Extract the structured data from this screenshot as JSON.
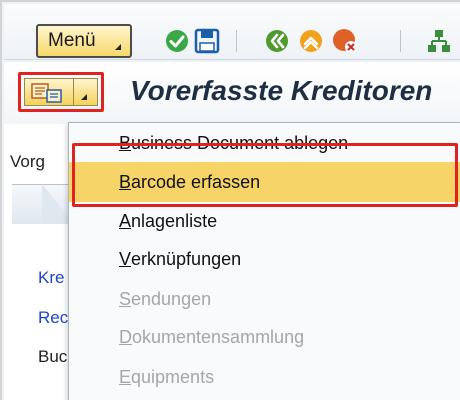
{
  "toolbar": {
    "menu_label": "Menü",
    "icons": [
      "check-icon",
      "save-icon",
      "back-icon",
      "exit-icon",
      "cancel-icon",
      "hierarchy-icon"
    ]
  },
  "title": {
    "text": "Vorerfasste Kreditoren"
  },
  "left_panel": {
    "label_top": "Vorg",
    "links": [
      "Kre",
      "Rec"
    ],
    "label_bottom": "Buc"
  },
  "dropdown": {
    "items": [
      {
        "label": "Business Document ablegen",
        "mnemonic": "B",
        "rest": "usiness Document ablegen",
        "enabled": true
      },
      {
        "label": "Barcode erfassen",
        "mnemonic": "B",
        "rest": "arcode erfassen",
        "enabled": true,
        "highlighted": true
      },
      {
        "label": "Anlagenliste",
        "mnemonic": "A",
        "rest": "nlagenliste",
        "enabled": true
      },
      {
        "label": "Verknüpfungen",
        "mnemonic": "V",
        "rest": "erknüpfungen",
        "enabled": true
      },
      {
        "label": "Sendungen",
        "mnemonic": "S",
        "rest": "endungen",
        "enabled": false
      },
      {
        "label": "Dokumentensammlung",
        "mnemonic": "D",
        "rest": "okumentensammlung",
        "enabled": false
      },
      {
        "label": "Equipments",
        "mnemonic": "E",
        "rest": "quipments",
        "enabled": false
      }
    ]
  },
  "colors": {
    "highlight": "#f6d468",
    "annotation_red": "#e0231f",
    "link_blue": "#1a47c6",
    "disabled": "#a6a6a6"
  }
}
